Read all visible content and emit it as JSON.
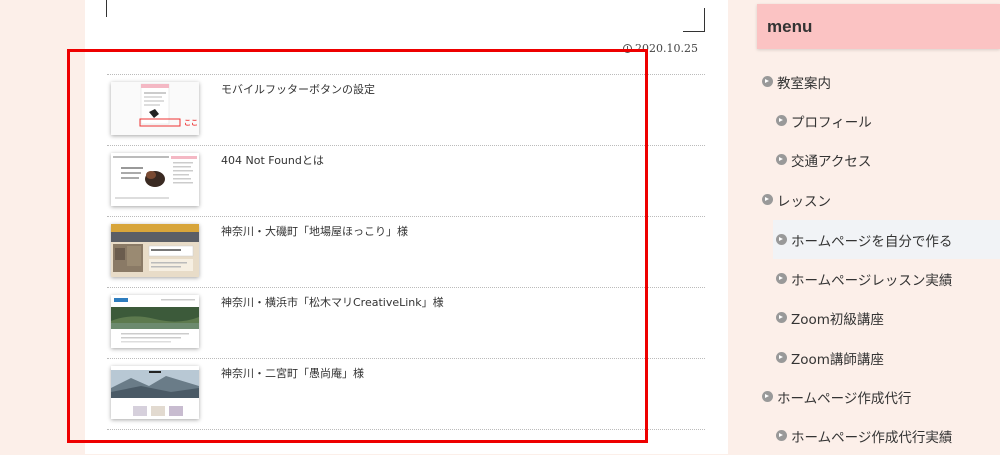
{
  "post": {
    "date": "2020.10.25",
    "related": [
      {
        "title": "モバイルフッターボタンの設定",
        "thumb": "mobile-footer",
        "thumb_label": "ここ"
      },
      {
        "title": "404 Not Foundとは",
        "thumb": "404"
      },
      {
        "title": "神奈川・大磯町「地場屋ほっこり」様",
        "thumb": "jibaya"
      },
      {
        "title": "神奈川・横浜市「松木マリCreativeLink」様",
        "thumb": "creativelink"
      },
      {
        "title": "神奈川・二宮町「愚尚庵」様",
        "thumb": "gushoan"
      }
    ]
  },
  "sidebar": {
    "heading": "menu",
    "items": [
      {
        "label": "教室案内",
        "level": 0
      },
      {
        "label": "プロフィール",
        "level": 1
      },
      {
        "label": "交通アクセス",
        "level": 1
      },
      {
        "label": "レッスン",
        "level": 0
      },
      {
        "label": "ホームページを自分で作る",
        "level": 1,
        "active": true
      },
      {
        "label": "ホームページレッスン実績",
        "level": 1
      },
      {
        "label": "Zoom初級講座",
        "level": 1
      },
      {
        "label": "Zoom講師講座",
        "level": 1
      },
      {
        "label": "ホームページ作成代行",
        "level": 0
      },
      {
        "label": "ホームページ作成代行実績",
        "level": 1
      }
    ]
  },
  "colors": {
    "page_bg": "#fcefe9",
    "menu_head_bg": "#fbc3c3",
    "highlight_border": "#e00000",
    "active_item_bg": "#f1f3f6"
  }
}
